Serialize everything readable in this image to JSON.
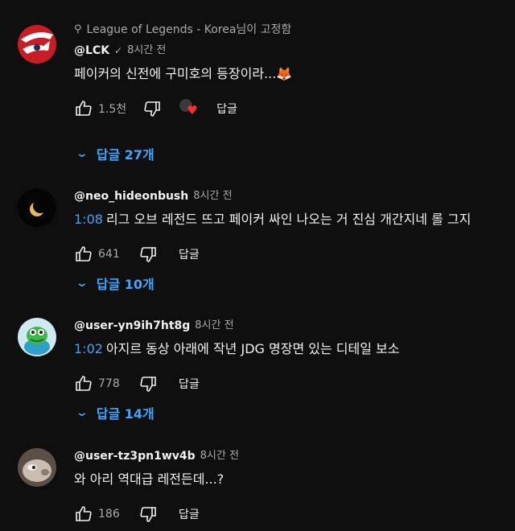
{
  "comments": [
    {
      "pinned_label": "League of Legends - Korea님이 고정함",
      "author": "@LCK",
      "verified": true,
      "time": "8시간 전",
      "timestamp": "",
      "text": "페이커의 신전에 구미호의 등장이라...🦊",
      "likes": "1.5천",
      "creator_heart": true,
      "reply_label": "답글",
      "replies_label": "답글 27개",
      "avatar_icon": "lck-logo-icon"
    },
    {
      "author": "@neo_hideonbush",
      "time": "8시간 전",
      "timestamp": "1:08",
      "text": "리그 오브 레전드 뜨고 페이커 싸인 나오는 거 진심 개간지네 롤 그지",
      "likes": "641",
      "reply_label": "답글",
      "replies_label": "답글 10개",
      "avatar_icon": "crescent-moon-icon"
    },
    {
      "author": "@user-yn9ih7ht8g",
      "time": "8시간 전",
      "timestamp": "1:02",
      "text": "아지르 동상 아래에 작년 JDG 명장면 있는 디테일 보소",
      "likes": "778",
      "reply_label": "답글",
      "replies_label": "답글 14개",
      "avatar_icon": "cartoon-character-icon"
    },
    {
      "author": "@user-tz3pn1wv4b",
      "time": "8시간 전",
      "timestamp": "",
      "text": "와 아리 역대급 레전든데...?",
      "likes": "186",
      "reply_label": "답글",
      "avatar_icon": "animal-photo-icon"
    }
  ],
  "colors": {
    "background": "#0f0f0f",
    "link": "#3ea6ff",
    "secondary_text": "#aaaaaa",
    "heart": "#ff2d2d"
  }
}
